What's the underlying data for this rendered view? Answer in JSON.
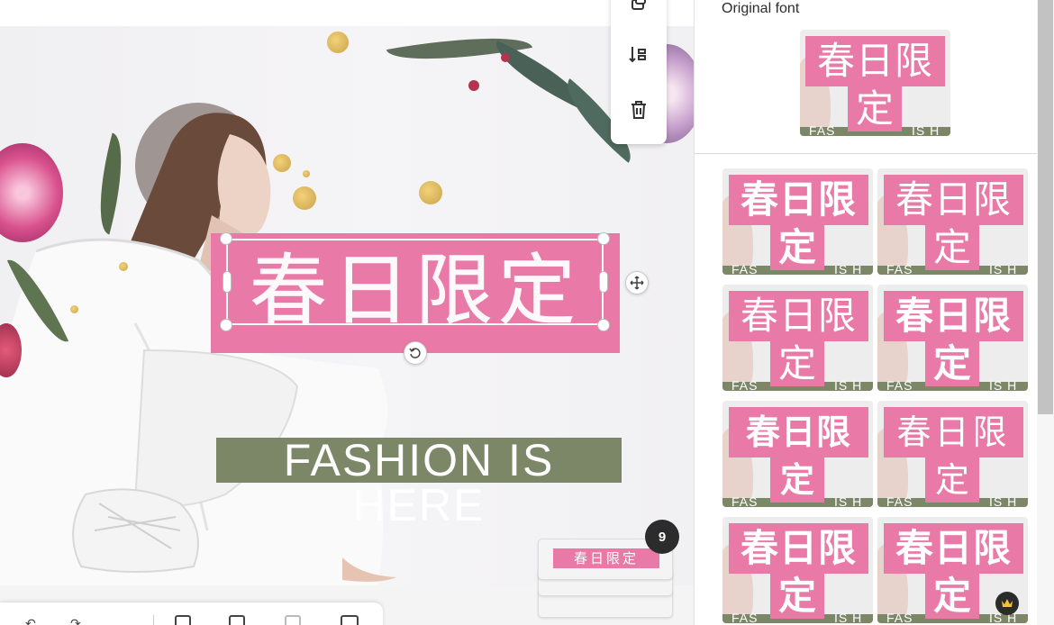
{
  "canvas": {
    "title_text": "春日限定",
    "subtitle_text": "FASHION IS HERE",
    "colors": {
      "pink": "#e97aa7",
      "green": "#7b8767",
      "white": "#ffffff"
    }
  },
  "floating_toolbar": {
    "items": [
      {
        "icon": "arrange-icon"
      },
      {
        "icon": "flip-icon"
      },
      {
        "icon": "trash-icon"
      }
    ]
  },
  "page_stack": {
    "thumb_label": "春日限定",
    "page_count": "9"
  },
  "font_panel": {
    "original_label": "Original font",
    "original_thumb": {
      "line1": "春日限",
      "line2": "定",
      "footer_left": "FAS",
      "footer_right": "IS H"
    },
    "thumbs": [
      {
        "line1": "春日限",
        "line2": "定",
        "footer_left": "FAS",
        "footer_right": "IS H",
        "style": "bold"
      },
      {
        "line1": "春日限",
        "line2": "定",
        "footer_left": "FAS",
        "footer_right": "IS H",
        "style": "light"
      },
      {
        "line1": "春日限",
        "line2": "定",
        "footer_left": "FAS",
        "footer_right": "IS H",
        "style": "serif-light"
      },
      {
        "line1": "春日限",
        "line2": "定",
        "footer_left": "FAS",
        "footer_right": "IS H",
        "style": "serif"
      },
      {
        "line1": "春日限",
        "line2": "定",
        "footer_left": "FAS",
        "footer_right": "IS H",
        "style": "bold"
      },
      {
        "line1": "春日限",
        "line2": "定",
        "footer_left": "FAS",
        "footer_right": "IS H",
        "style": "light"
      },
      {
        "line1": "春日限",
        "line2": "定",
        "footer_left": "FAS",
        "footer_right": "IS H",
        "style": "bold"
      },
      {
        "line1": "春日限",
        "line2": "定",
        "footer_left": "FAS",
        "footer_right": "IS H",
        "style": "mono"
      }
    ],
    "premium_icon": "crown-icon"
  },
  "bottom_toolbar": {
    "icons": [
      "undo-icon",
      "redo-icon",
      "comment-icon",
      "duplicate-icon",
      "delete-page-icon",
      "grid-icon"
    ]
  }
}
